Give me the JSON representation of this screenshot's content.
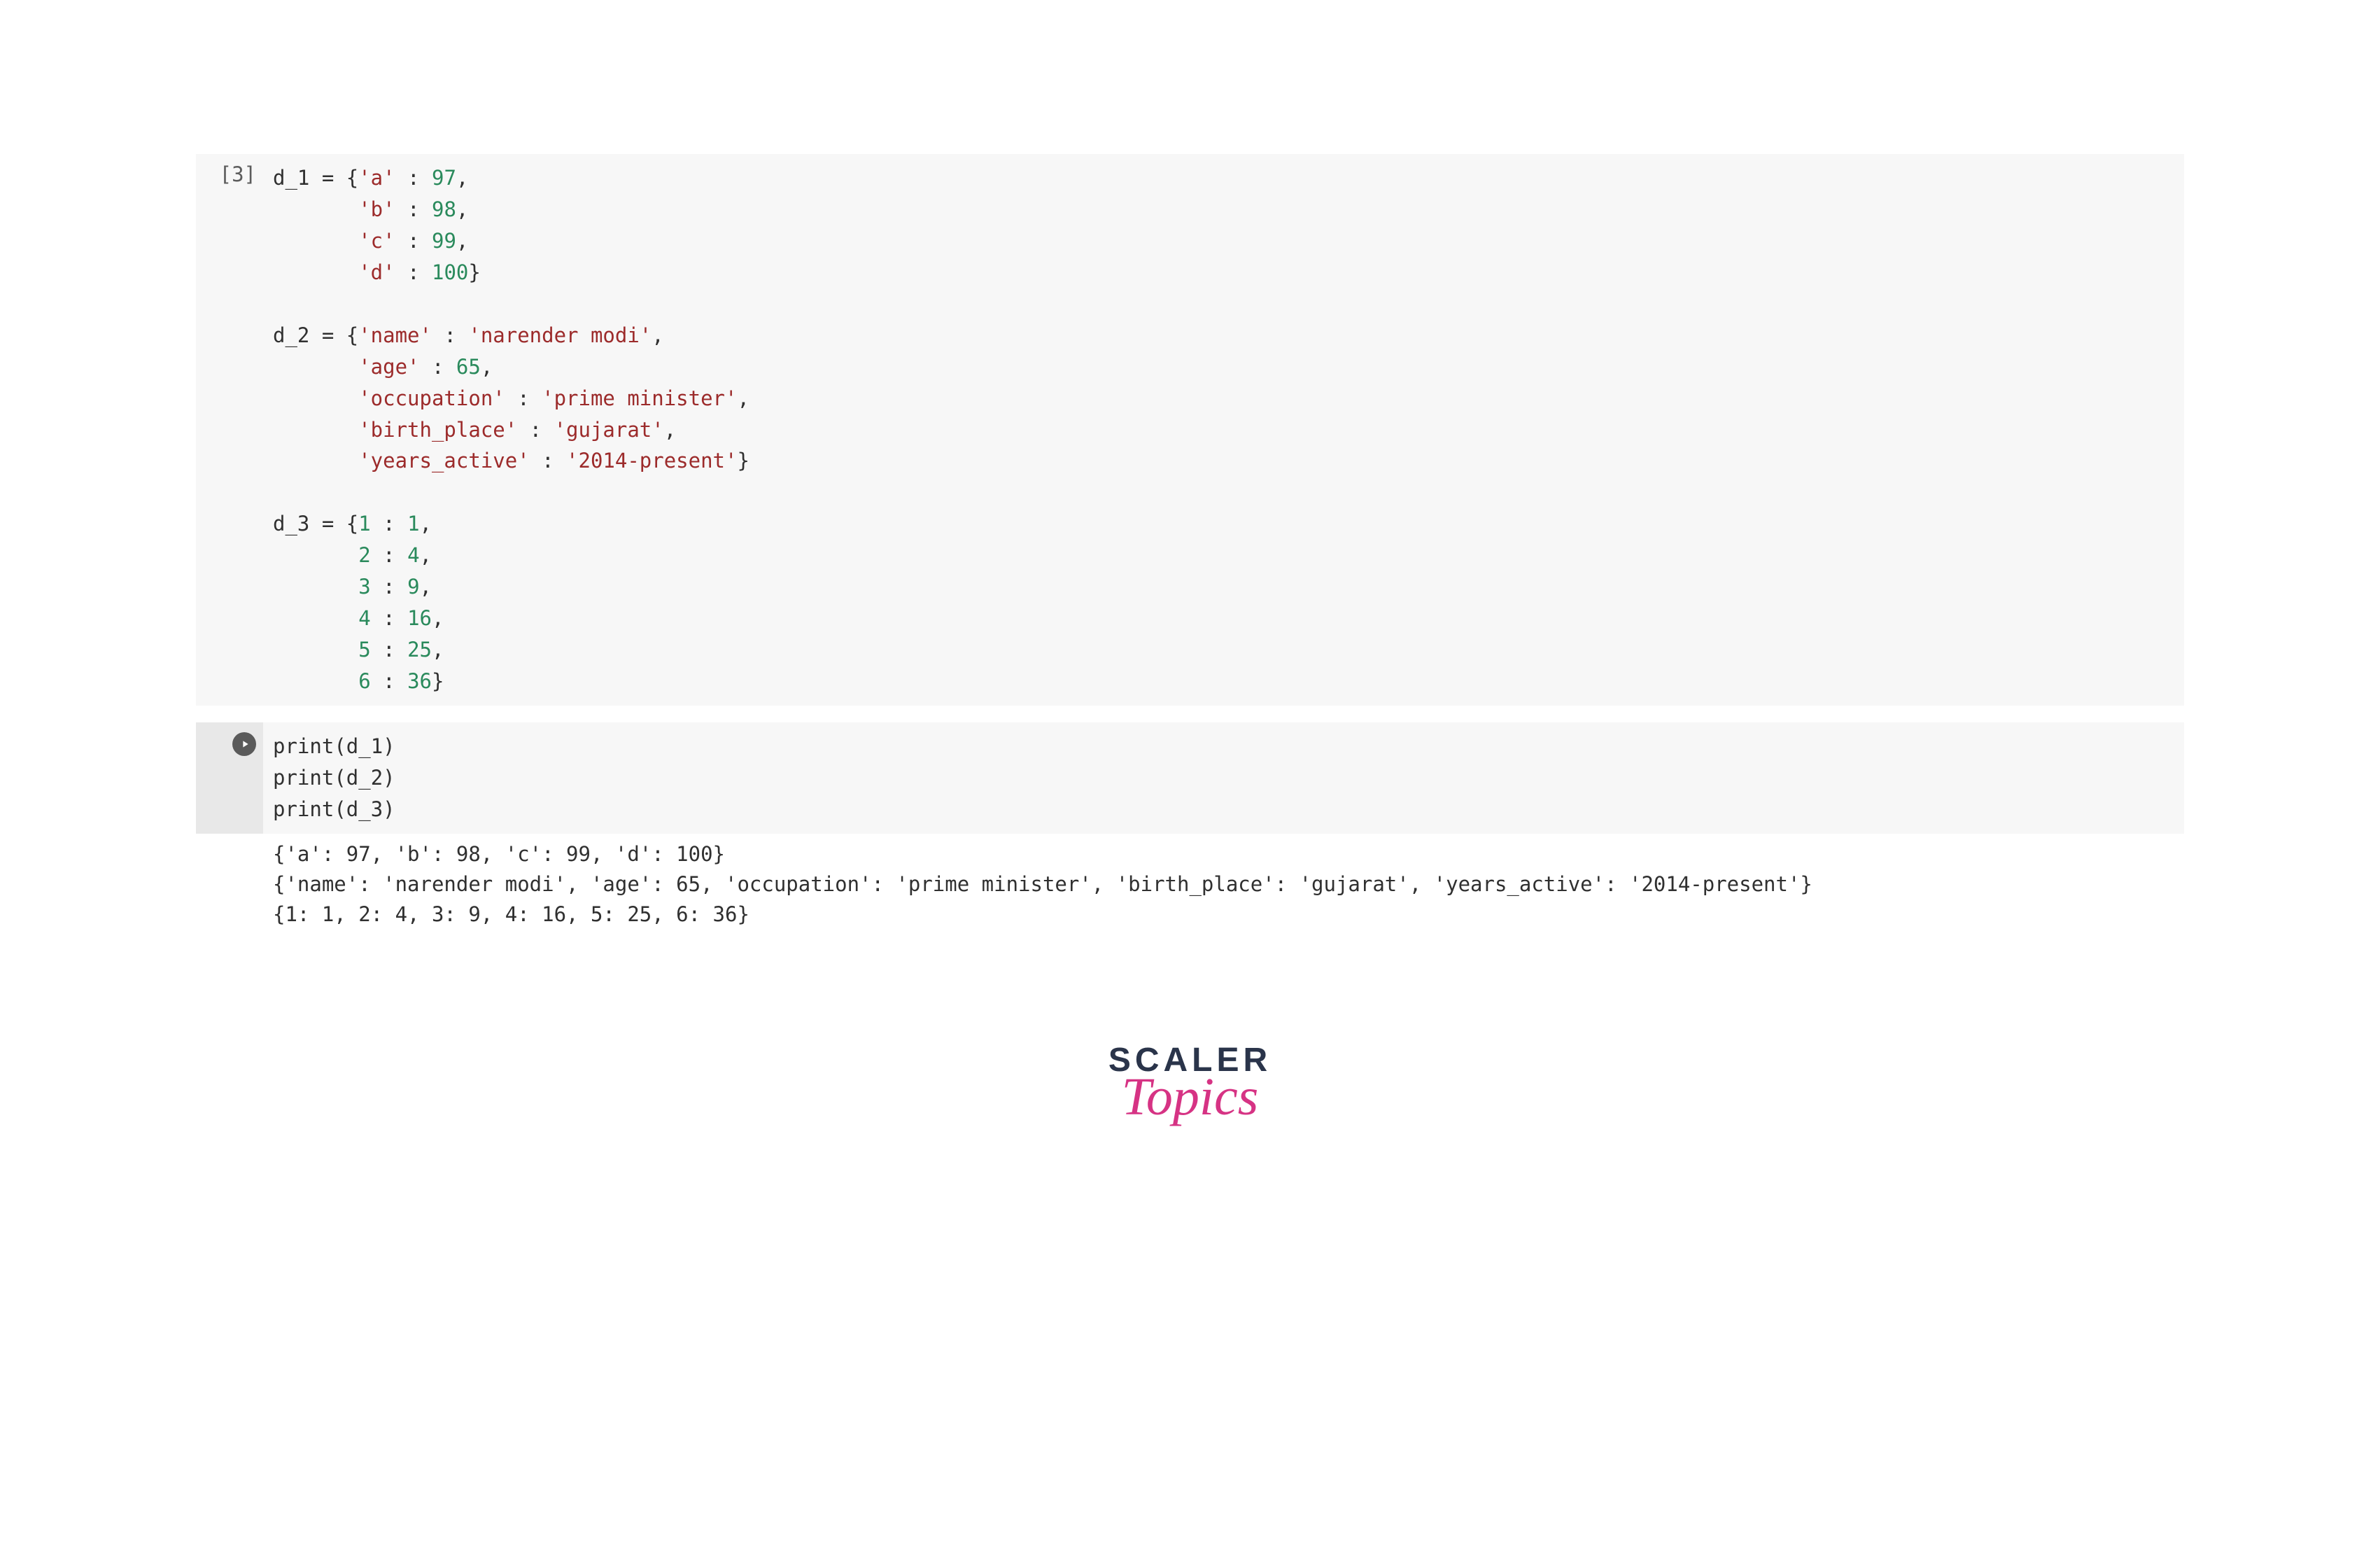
{
  "cell1": {
    "prompt": "[3]",
    "line1_pre": "d_1 = {",
    "k1": "'a'",
    "v1": "97",
    "c1": ",",
    "pad": "       ",
    "k2": "'b'",
    "v2": "98",
    "c2": ",",
    "k3": "'c'",
    "v3": "99",
    "c3": ",",
    "k4": "'d'",
    "v4": "100",
    "end1": "}",
    "blank1": "",
    "line2_pre": "d_2 = {",
    "k5": "'name'",
    "v5": "'narender modi'",
    "c5": ",",
    "k6": "'age'",
    "v6": "65",
    "c6": ",",
    "k7": "'occupation'",
    "v7": "'prime minister'",
    "c7": ",",
    "k8": "'birth_place'",
    "v8": "'gujarat'",
    "c8": ",",
    "k9": "'years_active'",
    "v9": "'2014-present'",
    "end2": "}",
    "blank2": "",
    "line3_pre": "d_3 = {",
    "k10": "1",
    "v10": "1",
    "c10": ",",
    "k11": "2",
    "v11": "4",
    "c11": ",",
    "k12": "3",
    "v12": "9",
    "c12": ",",
    "k13": "4",
    "v13": "16",
    "c13": ",",
    "k14": "5",
    "v14": "25",
    "c14": ",",
    "k15": "6",
    "v15": "36",
    "end3": "}",
    "colon": " : "
  },
  "cell2": {
    "fn": "print",
    "a1": "d_1",
    "a2": "d_2",
    "a3": "d_3",
    "op": "(",
    "cp": ")"
  },
  "output": {
    "line1": "{'a': 97, 'b': 98, 'c': 99, 'd': 100}",
    "line2": "{'name': 'narender modi', 'age': 65, 'occupation': 'prime minister', 'birth_place': 'gujarat', 'years_active': '2014-present'}",
    "line3": "{1: 1, 2: 4, 3: 9, 4: 16, 5: 25, 6: 36}"
  },
  "logo": {
    "scaler": "SCALER",
    "topics": "Topics"
  }
}
